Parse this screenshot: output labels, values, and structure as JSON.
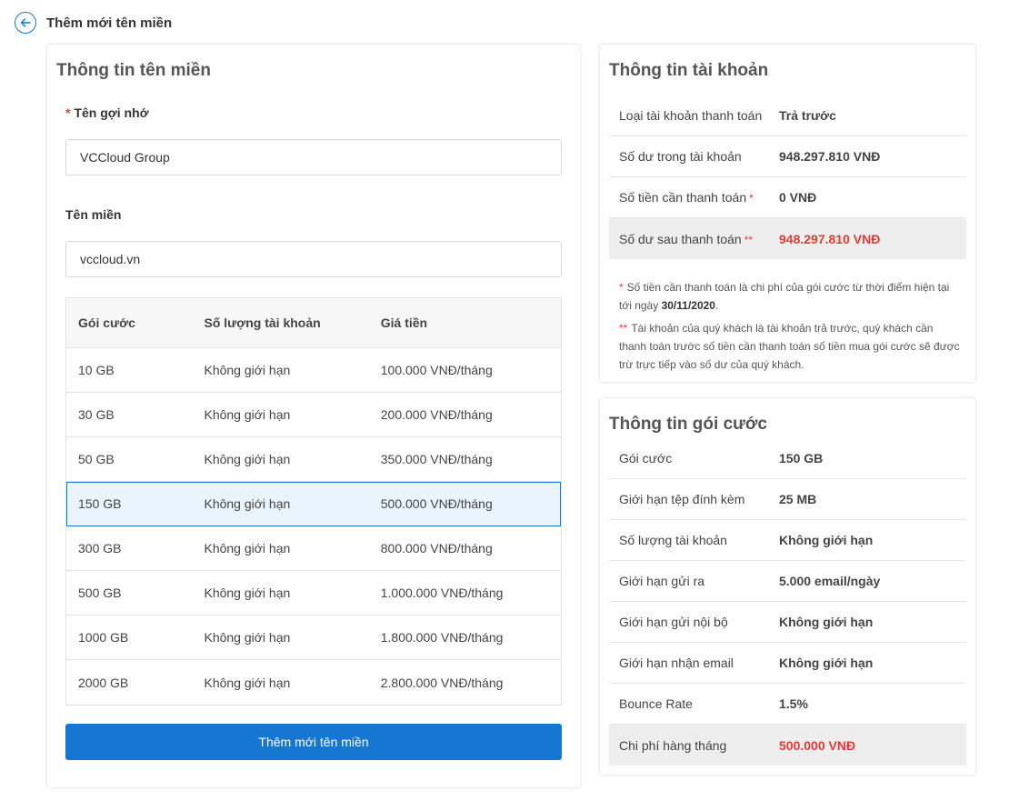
{
  "header": {
    "title": "Thêm mới tên miền"
  },
  "domain_card": {
    "title": "Thông tin tên miền",
    "alias_label": "Tên gợi nhớ",
    "alias_value": "VCCloud Group",
    "domain_label": "Tên miền",
    "domain_value": "vccloud.vn",
    "table": {
      "headers": [
        "Gói cước",
        "Số lượng tài khoản",
        "Giá tiền"
      ],
      "rows": [
        [
          "10 GB",
          "Không giới hạn",
          "100.000 VNĐ/tháng"
        ],
        [
          "30 GB",
          "Không giới hạn",
          "200.000 VNĐ/tháng"
        ],
        [
          "50 GB",
          "Không giới hạn",
          "350.000 VNĐ/tháng"
        ],
        [
          "150 GB",
          "Không giới hạn",
          "500.000 VNĐ/tháng"
        ],
        [
          "300 GB",
          "Không giới hạn",
          "800.000 VNĐ/tháng"
        ],
        [
          "500 GB",
          "Không giới hạn",
          "1.000.000 VNĐ/tháng"
        ],
        [
          "1000 GB",
          "Không giới hạn",
          "1.800.000 VNĐ/tháng"
        ],
        [
          "2000 GB",
          "Không giới hạn",
          "2.800.000 VNĐ/tháng"
        ]
      ],
      "selected_index": 3
    },
    "submit_label": "Thêm mới tên miền"
  },
  "account_card": {
    "title": "Thông tin tài khoản",
    "rows": [
      {
        "label": "Loại tài khoản thanh toán",
        "value": "Trả trước",
        "mark": ""
      },
      {
        "label": "Số dư trong tài khoản",
        "value": "948.297.810 VNĐ",
        "mark": ""
      },
      {
        "label": "Số tiền cần thanh toán",
        "value": "0 VNĐ",
        "mark": "*"
      },
      {
        "label": "Số dư sau thanh toán",
        "value": "948.297.810 VNĐ",
        "mark": "**"
      }
    ],
    "note1_mark": "*",
    "note1_text": "Số tiền cần thanh toán là chi phí của gói cước từ thời điểm hiện tại tới ngày",
    "note1_date": "30/11/2020",
    "note1_end": ".",
    "note2_mark": "**",
    "note2_text": "Tài khoản của quý khách là tài khoản trả trước, quý khách cần thanh toán trước số tiền cần thanh toán số tiền mua gói cước sẽ được trừ trực tiếp vào số dư của quý khách."
  },
  "plan_card": {
    "title": "Thông tin gói cước",
    "rows": [
      {
        "label": "Gói cước",
        "value": "150 GB"
      },
      {
        "label": "Giới hạn tệp đính kèm",
        "value": "25 MB"
      },
      {
        "label": "Số lượng tài khoản",
        "value": "Không giới hạn"
      },
      {
        "label": "Giới hạn gửi ra",
        "value": "5.000 email/ngày"
      },
      {
        "label": "Giới hạn gửi nội bộ",
        "value": "Không giới hạn"
      },
      {
        "label": "Giới hạn nhận email",
        "value": "Không giới hạn"
      },
      {
        "label": "Bounce Rate",
        "value": "1.5%"
      },
      {
        "label": "Chi phí hàng tháng",
        "value": "500.000 VNĐ"
      }
    ]
  },
  "colors": {
    "accent": "#1677d2",
    "danger": "#e53935",
    "highlight_bg": "#eeeeee",
    "selected_bg": "#eaf4fc"
  },
  "icons": {
    "back": "arrow-left-circle-icon"
  }
}
